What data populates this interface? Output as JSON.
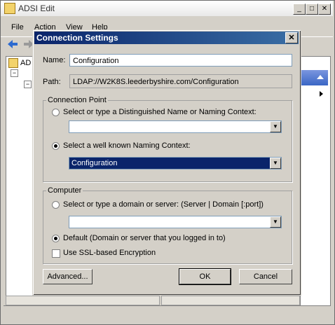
{
  "app": {
    "title": "ADSI Edit"
  },
  "menus": [
    "File",
    "Action",
    "View",
    "Help"
  ],
  "tree": {
    "root_label": "AD"
  },
  "dialog": {
    "title": "Connection Settings",
    "name_label": "Name:",
    "name_value": "Configuration",
    "path_label": "Path:",
    "path_value": "LDAP://W2K8S.leederbyshire.com/Configuration",
    "connection_point": {
      "caption": "Connection Point",
      "option_dn_label": "Select or type a Distinguished Name or Naming Context:",
      "option_dn_selected": false,
      "dn_value": "",
      "option_known_label": "Select a well known Naming Context:",
      "option_known_selected": true,
      "known_value": "Configuration"
    },
    "computer": {
      "caption": "Computer",
      "option_server_label": "Select or type a domain or server: (Server | Domain [:port])",
      "option_server_selected": false,
      "server_value": "",
      "option_default_label": "Default (Domain or server that you logged in to)",
      "option_default_selected": true,
      "ssl_label": "Use SSL-based Encryption",
      "ssl_checked": false
    },
    "buttons": {
      "advanced": "Advanced...",
      "ok": "OK",
      "cancel": "Cancel"
    }
  },
  "colors": {
    "dialog_title": "#0a246a",
    "selection": "#0a246a",
    "face": "#d4d0c8"
  }
}
